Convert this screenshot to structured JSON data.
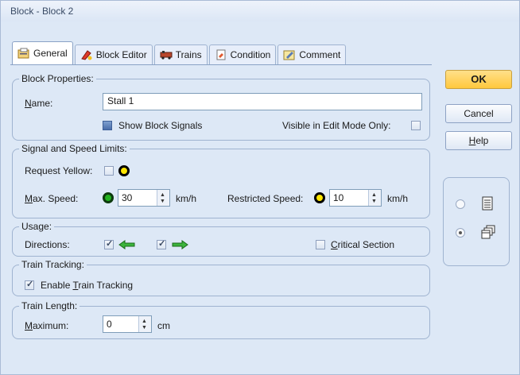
{
  "window": {
    "title": "Block - Block 2"
  },
  "tabs": [
    {
      "label": "General",
      "icon": "general-properties-icon"
    },
    {
      "label": "Block Editor",
      "icon": "block-editor-icon"
    },
    {
      "label": "Trains",
      "icon": "trains-icon"
    },
    {
      "label": "Condition",
      "icon": "condition-icon"
    },
    {
      "label": "Comment",
      "icon": "comment-icon"
    }
  ],
  "block_properties": {
    "title": "Block Properties:",
    "name_label": "Name:",
    "name_value": "Stall 1",
    "show_block_signals_label": "Show Block Signals",
    "show_block_signals_checked": true,
    "visible_edit_mode_label": "Visible in Edit Mode Only:",
    "visible_edit_mode_checked": false
  },
  "signal_speed": {
    "title": "Signal and Speed Limits:",
    "request_yellow_label": "Request Yellow:",
    "request_yellow_checked": false,
    "max_speed_label": "Max. Speed:",
    "max_speed_value": "30",
    "max_speed_unit": "km/h",
    "restricted_speed_label": "Restricted Speed:",
    "restricted_speed_value": "10",
    "restricted_speed_unit": "km/h"
  },
  "usage": {
    "title": "Usage:",
    "directions_label": "Directions:",
    "direction_left_checked": true,
    "direction_right_checked": true,
    "critical_section_label": "Critical Section",
    "critical_section_checked": false
  },
  "train_tracking": {
    "title": "Train Tracking:",
    "enable_label": "Enable Train Tracking",
    "enable_checked": true
  },
  "train_length": {
    "title": "Train Length:",
    "maximum_label": "Maximum:",
    "maximum_value": "0",
    "unit": "cm"
  },
  "buttons": {
    "ok": "OK",
    "cancel": "Cancel",
    "help": "Help"
  },
  "view_mode": {
    "selected": "second"
  },
  "colors": {
    "background": "#dde8f6",
    "ok_button": "#ffc83d",
    "yellow_signal": "#ffe600",
    "green_signal": "#22b21e",
    "arrow_green": "#3cb43c"
  }
}
